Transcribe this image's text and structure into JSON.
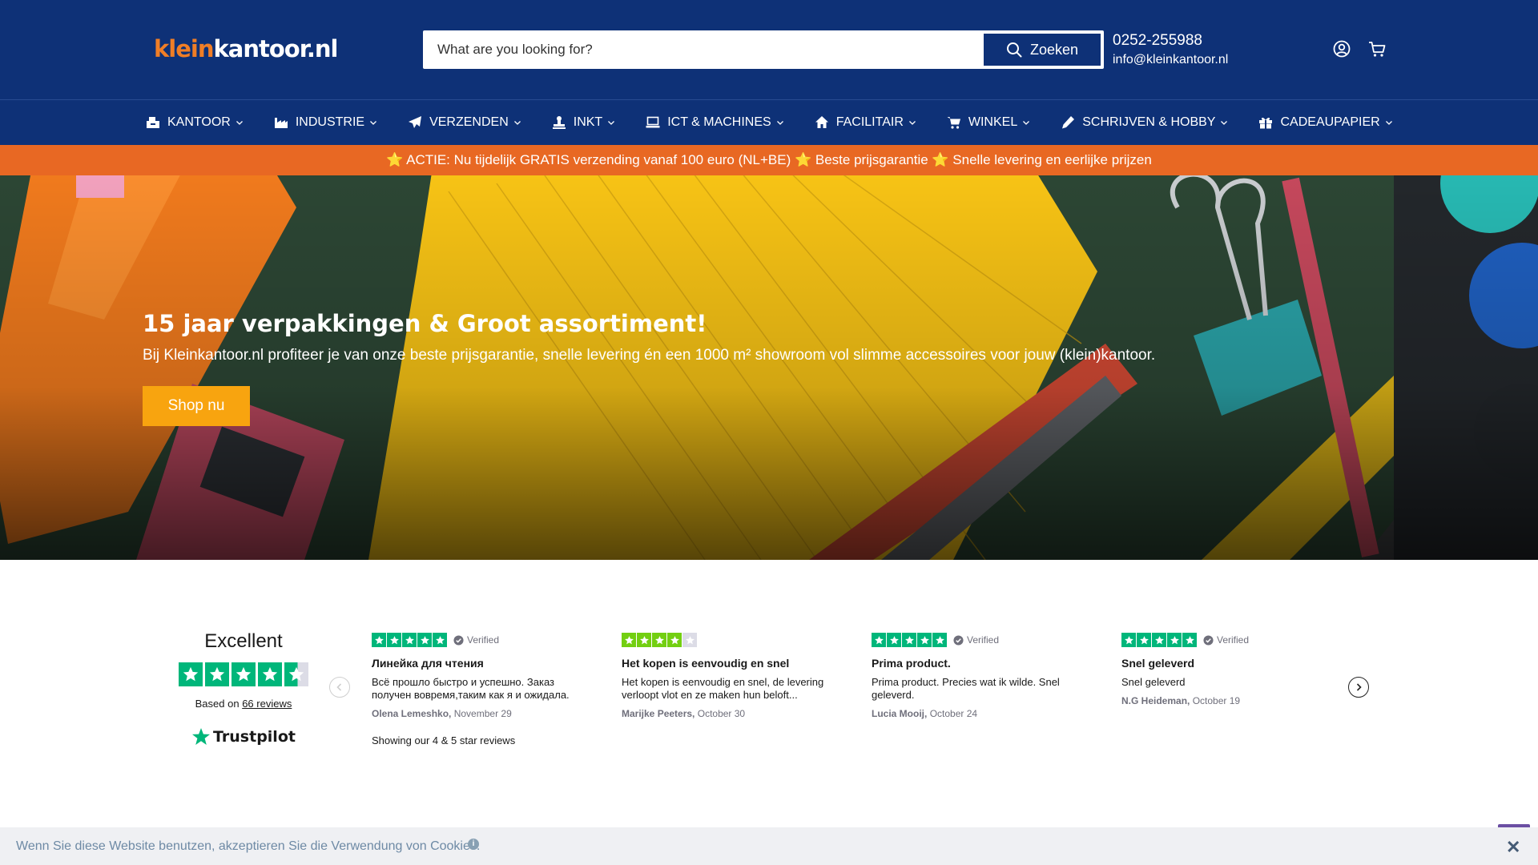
{
  "header": {
    "logo_part1": "klein",
    "logo_part2": "kantoor.nl",
    "search_placeholder": "What are you looking for?",
    "search_button": "Zoeken",
    "phone": "0252-255988",
    "email": "info@kleinkantoor.nl"
  },
  "nav": {
    "items": [
      {
        "label": "KANTOOR",
        "icon": "office-supplies-icon"
      },
      {
        "label": "INDUSTRIE",
        "icon": "factory-icon"
      },
      {
        "label": "VERZENDEN",
        "icon": "paper-plane-icon"
      },
      {
        "label": "INKT",
        "icon": "stamp-icon"
      },
      {
        "label": "ICT & MACHINES",
        "icon": "laptop-icon"
      },
      {
        "label": "FACILITAIR",
        "icon": "home-icon"
      },
      {
        "label": "WINKEL",
        "icon": "shopping-cart-icon"
      },
      {
        "label": "SCHRIJVEN & HOBBY",
        "icon": "pen-icon"
      },
      {
        "label": "CADEAUPAPIER",
        "icon": "gift-icon"
      }
    ]
  },
  "promo": {
    "text": "⭐ ACTIE: Nu tijdelijk GRATIS verzending vanaf 100 euro (NL+BE) ⭐ Beste prijsgarantie ⭐ Snelle levering en eerlijke prijzen"
  },
  "hero": {
    "title": "15 jaar verpakkingen & Groot assortiment!",
    "subtitle": "Bij Kleinkantoor.nl profiteer je van onze beste prijsgarantie, snelle levering én een 1000 m² showroom vol slimme accessoires voor jouw (klein)kantoor.",
    "button": "Shop nu"
  },
  "trustpilot": {
    "rating_word": "Excellent",
    "stars": 4.5,
    "based_on_prefix": "Based on",
    "review_count": "66 reviews",
    "brand": "Trustpilot",
    "showing": "Showing our 4 & 5 star reviews",
    "reviews": [
      {
        "stars": 5,
        "verified": "Verified",
        "title": "Линейка для чтения",
        "body": "Всё прошло быстро и успешно. Заказ получен вовремя,таким как я и ожидала.",
        "author": "Olena Lemeshko,",
        "date": "November 29"
      },
      {
        "stars": 4,
        "verified": "",
        "title": "Het kopen is eenvoudig en snel",
        "body": "Het kopen is eenvoudig en snel, de levering verloopt vlot en ze maken hun beloft...",
        "author": "Marijke Peeters,",
        "date": "October 30"
      },
      {
        "stars": 5,
        "verified": "Verified",
        "title": "Prima product.",
        "body": "Prima product. Precies wat ik wilde. Snel geleverd.",
        "author": "Lucia Mooij,",
        "date": "October 24"
      },
      {
        "stars": 5,
        "verified": "Verified",
        "title": "Snel geleverd",
        "body": "Snel geleverd",
        "author": "N.G Heideman,",
        "date": "October 19"
      }
    ]
  },
  "cookie": {
    "text": "Wenn Sie diese Website benutzen, akzeptieren Sie die Verwendung von Cookies.",
    "info": "i",
    "close": "✕"
  },
  "colors": {
    "header_bg": "#0e3177",
    "promo_bg": "#e86823",
    "logo_orange": "#f07e26",
    "cta_yellow": "#f8a40f",
    "trustpilot_green": "#00b67a"
  }
}
